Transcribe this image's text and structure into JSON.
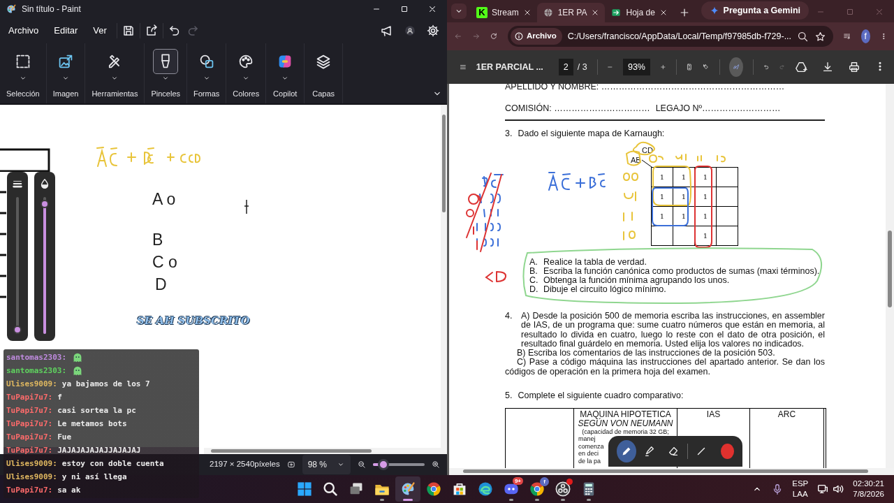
{
  "paint": {
    "title": "Sin título - Paint",
    "menu": [
      "Archivo",
      "Editar",
      "Ver"
    ],
    "redo_disabled": true,
    "ribbon": [
      {
        "label": "Selección",
        "kind": "select",
        "dropdown": true,
        "selected": false
      },
      {
        "label": "Imagen",
        "kind": "image",
        "dropdown": true,
        "selected": false
      },
      {
        "label": "Herramientas",
        "kind": "tools",
        "dropdown": true,
        "selected": false
      },
      {
        "label": "Pinceles",
        "kind": "brush",
        "dropdown": true,
        "selected": true
      },
      {
        "label": "Formas",
        "kind": "shapes",
        "dropdown": true,
        "selected": false
      },
      {
        "label": "Colores",
        "kind": "palette",
        "dropdown": true,
        "selected": false
      },
      {
        "label": "Copilot",
        "kind": "copilot",
        "dropdown": true,
        "selected": false
      },
      {
        "label": "Capas",
        "kind": "layers",
        "dropdown": false,
        "selected": false
      }
    ],
    "canvas": {
      "notes": [
        "A o",
        "B",
        "C o",
        "D"
      ],
      "overlay_text": "SE AH SUBSCRITO"
    },
    "brush_sliders": [
      {
        "kind": "size",
        "level": 0.03
      },
      {
        "kind": "opacity",
        "level": 0.95
      }
    ],
    "status": {
      "size": "2197 × 2540píxeles",
      "zoom": "98 %",
      "zoom_slider": {
        "level": 0.2
      }
    }
  },
  "chat": [
    {
      "user": "santomas2303:",
      "color": "#c08be0",
      "kind": "emote"
    },
    {
      "user": "santomas2303:",
      "color": "#5fd35f",
      "kind": "emote"
    },
    {
      "user": "Ulises9009:",
      "color": "#e0b860",
      "kind": "text",
      "text": "ya bajamos de los 7"
    },
    {
      "user": "TuPapi7u7:",
      "color": "#ff6b6b",
      "kind": "text",
      "text": "f"
    },
    {
      "user": "TuPapi7u7:",
      "color": "#ff6b6b",
      "kind": "text",
      "text": "casi sortea la pc"
    },
    {
      "user": "TuPapi7u7:",
      "color": "#ff6b6b",
      "kind": "text",
      "text": "Le metamos bots"
    },
    {
      "user": "TuPapi7u7:",
      "color": "#ff6b6b",
      "kind": "text",
      "text": "Fue"
    },
    {
      "user": "TuPapi7u7:",
      "color": "#ff6b6b",
      "kind": "text",
      "text": "JAJAJAJAJAJJAJAJAJ"
    },
    {
      "user": "Ulises9009:",
      "color": "#e0b860",
      "kind": "text",
      "text": "estoy con doble cuenta"
    },
    {
      "user": "Ulises9009:",
      "color": "#e0b860",
      "kind": "text",
      "text": "y ni así llega"
    },
    {
      "user": "TuPapi7u7:",
      "color": "#ff6b6b",
      "kind": "text",
      "text": "sa ak"
    }
  ],
  "browser": {
    "tabs": [
      {
        "title": "Stream",
        "kind": "kick",
        "icon_text": "K",
        "selected": false
      },
      {
        "title": "1ER PA",
        "kind": "globe",
        "selected": true
      },
      {
        "title": "Hoja de",
        "kind": "sheet",
        "selected": false
      }
    ],
    "gemini": "Pregunta a Gemini",
    "forward_disabled": true,
    "address": {
      "chip": "Archivo",
      "url": "C:/Users/francisco/AppData/Local/Temp/f97985db-f729-..."
    },
    "profile": "f",
    "pdf_toolbar": {
      "title": "1ER PARCIAL ...",
      "page": "2",
      "total": "/ 3",
      "zoom": "93%",
      "annotate_on": true,
      "redo_disabled": true
    },
    "document": {
      "name_line": "APELLIDO Y NOMBRE: ………………………………………………………",
      "commission": "COMISIÓN: ……………………………",
      "record": "LEGAJO Nº………………………",
      "q3": {
        "number": "3.",
        "text": "Dado el siguiente mapa de Karnaugh:",
        "kmap": {
          "col_var": "CD",
          "row_var": "AB",
          "cells": [
            [
              "1",
              "1",
              "1",
              null
            ],
            [
              "1",
              "1",
              "1",
              null
            ],
            [
              "1",
              "1",
              "1",
              null
            ],
            [
              null,
              null,
              "1",
              null
            ]
          ]
        },
        "items": [
          {
            "letter": "A.",
            "text": "Realice la tabla de verdad."
          },
          {
            "letter": "B.",
            "text": "Escriba la función canónica como productos de sumas (maxi términos)."
          },
          {
            "letter": "C.",
            "text": "Obtenga la función mínima agrupando los unos."
          },
          {
            "letter": "D.",
            "text": "Dibuje el circuito lógico mínimo."
          }
        ]
      },
      "q4": {
        "number": "4.",
        "parts": [
          "A) Desde la posición 500 de memoria escriba las instrucciones, en assembler de IAS, de un programa que: sume cuatro números que están en memoria, al resultado lo divida en cuatro, luego lo reste con el dato de otra posición, el resultado final guárdelo en memoria. Usted elija los valores no indicados.",
          "B) Escriba los comentarios de las instrucciones de la posición 503.",
          "C) Pase a código máquina las instrucciones del apartado anterior. Se dan los códigos de operación en la primera hoja del examen."
        ]
      },
      "q5": {
        "number": "5.",
        "text": "Complete el siguiente cuadro comparativo:",
        "headers": [
          {
            "title": "MAQUINA HIPOTETICA",
            "subtitle": "SEGÚN VON NEUMANN",
            "notes": [
              "(capacidad de memoria 32 GB;",
              "manej",
              "comenza",
              "en deci",
              "de la pa"
            ]
          },
          {
            "title": "IAS"
          },
          {
            "title": "ARC"
          }
        ]
      }
    },
    "ink_toolbar": {
      "tools": [
        {
          "kind": "pen",
          "selected": true
        },
        {
          "kind": "highlighter",
          "selected": false
        },
        {
          "kind": "eraser",
          "selected": false
        },
        {
          "kind": "line",
          "selected": false
        }
      ],
      "color": "#e0312e"
    }
  },
  "taskbar": {
    "apps": [
      {
        "kind": "start",
        "running": false,
        "active": false
      },
      {
        "kind": "search",
        "running": false,
        "active": false
      },
      {
        "kind": "taskview",
        "running": false,
        "active": false
      },
      {
        "kind": "folder",
        "running": true,
        "active": false
      },
      {
        "kind": "paint",
        "running": true,
        "active": true
      },
      {
        "kind": "chrome",
        "running": false,
        "active": false
      },
      {
        "kind": "store",
        "running": false,
        "active": false
      },
      {
        "kind": "edge",
        "running": false,
        "active": false
      },
      {
        "kind": "discord",
        "running": true,
        "active": false,
        "badge": "9+"
      },
      {
        "kind": "chrome",
        "running": true,
        "active": false,
        "badge": "f"
      },
      {
        "kind": "obs",
        "running": true,
        "active": false,
        "alert": true
      },
      {
        "kind": "calc",
        "running": true,
        "active": false
      }
    ],
    "tray": {
      "lang": "ESP",
      "region": "LAA",
      "time": "02:30:21",
      "date": "7/8/2026"
    }
  }
}
